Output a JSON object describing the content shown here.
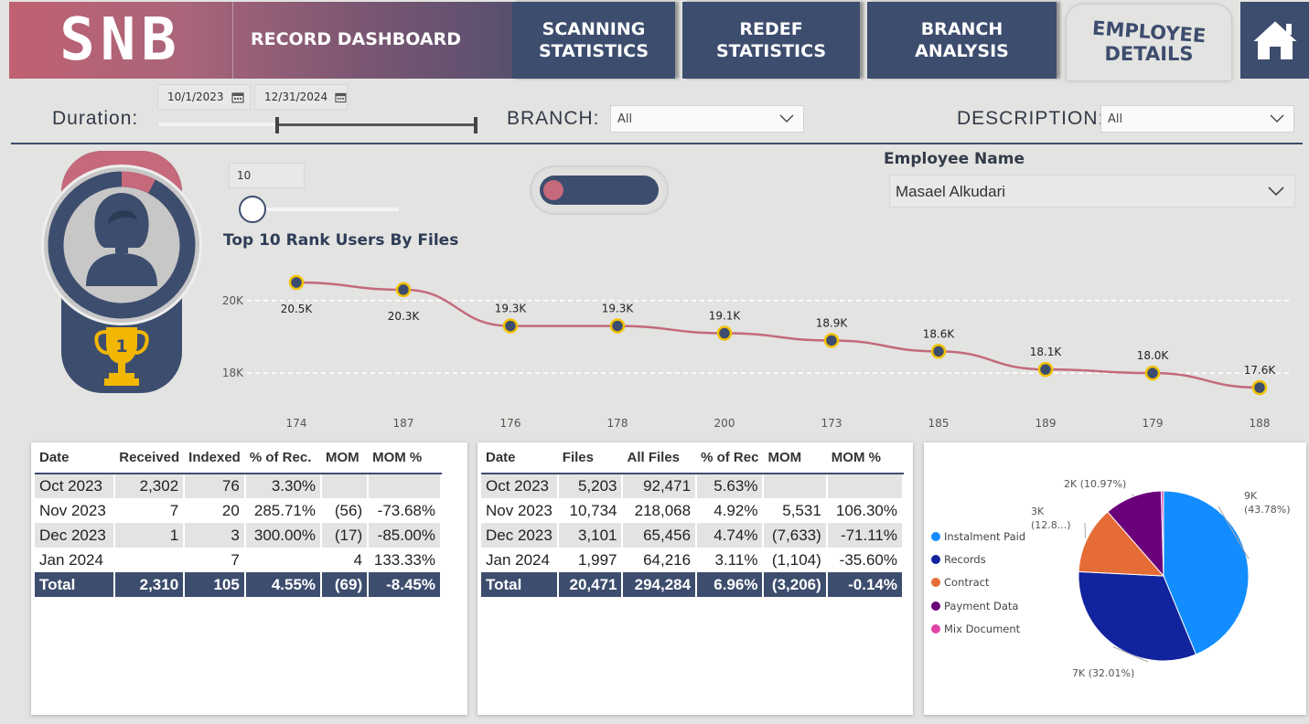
{
  "header": {
    "logo": "SNB",
    "title": "RECORD DASHBOARD",
    "tabs": [
      {
        "label_line1": "SCANNING",
        "label_line2": "STATISTICS"
      },
      {
        "label_line1": "REDEF",
        "label_line2": "STATISTICS"
      },
      {
        "label_line1": "BRANCH",
        "label_line2": "ANALYSIS"
      },
      {
        "label_line1": "EMPLOYEE",
        "label_line2": "DETAILS"
      }
    ],
    "home_icon": "home-icon"
  },
  "filters": {
    "duration_label": "Duration:",
    "start_date": "10/1/2023",
    "end_date": "12/31/2024",
    "branch_label": "BRANCH:",
    "branch_value": "All",
    "description_label": "DESCRIPTION:",
    "description_value": "All"
  },
  "rank": {
    "top_n_value": "10",
    "rank_number": "1",
    "chart_title": "Top 10 Rank Users By Files"
  },
  "employee": {
    "label": "Employee Name",
    "value": "Masael Alkudari"
  },
  "chart_data": [
    {
      "type": "line",
      "title": "Top 10 Rank Users By Files",
      "categories": [
        "174",
        "187",
        "176",
        "178",
        "200",
        "173",
        "185",
        "189",
        "179",
        "188"
      ],
      "values": [
        20500,
        20300,
        19300,
        19300,
        19100,
        18900,
        18600,
        18100,
        18000,
        17600
      ],
      "data_labels": [
        "20.5K",
        "20.3K",
        "19.3K",
        "19.3K",
        "19.1K",
        "18.9K",
        "18.6K",
        "18.1K",
        "18.0K",
        "17.6K"
      ],
      "y_ticks": [
        {
          "value": 18000,
          "label": "18K"
        },
        {
          "value": 20000,
          "label": "20K"
        }
      ],
      "ylim": [
        17250,
        20950
      ],
      "line_color": "#c26a7a",
      "marker_color": "#3d4d6e",
      "marker_edge": "#f2c200"
    },
    {
      "type": "pie",
      "slices": [
        {
          "name": "Instalment Paid",
          "label": "9K (43.78%)",
          "value": 43.78,
          "color": "#118dff"
        },
        {
          "name": "Records",
          "label": "7K (32.01%)",
          "value": 32.01,
          "color": "#12239e"
        },
        {
          "name": "Contract",
          "label": "3K (12.8...)",
          "value": 12.8,
          "color": "#e66c37"
        },
        {
          "name": "Payment Data",
          "label": "2K (10.97%)",
          "value": 10.97,
          "color": "#6b007b"
        },
        {
          "name": "Mix Document",
          "label": "",
          "value": 0.44,
          "color": "#e044a7"
        }
      ]
    }
  ],
  "table1": {
    "headers": [
      "Date",
      "Received",
      "Indexed",
      "% of Rec.",
      "MOM",
      "MOM %"
    ],
    "rows": [
      [
        "Oct 2023",
        "2,302",
        "76",
        "3.30%",
        "",
        ""
      ],
      [
        "Nov 2023",
        "7",
        "20",
        "285.71%",
        "(56)",
        "-73.68%"
      ],
      [
        "Dec 2023",
        "1",
        "3",
        "300.00%",
        "(17)",
        "-85.00%"
      ],
      [
        "Jan 2024",
        "",
        "7",
        "",
        "4",
        "133.33%"
      ]
    ],
    "total": [
      "Total",
      "2,310",
      "105",
      "4.55%",
      "(69)",
      "-8.45%"
    ]
  },
  "table2": {
    "headers": [
      "Date",
      "Files",
      "All Files",
      "% of Rec",
      "MOM",
      "MOM %"
    ],
    "rows": [
      [
        "Oct 2023",
        "5,203",
        "92,471",
        "5.63%",
        "",
        ""
      ],
      [
        "Nov 2023",
        "10,734",
        "218,068",
        "4.92%",
        "5,531",
        "106.30%"
      ],
      [
        "Dec 2023",
        "3,101",
        "65,456",
        "4.74%",
        "(7,633)",
        "-71.11%"
      ],
      [
        "Jan 2024",
        "1,997",
        "64,216",
        "3.11%",
        "(1,104)",
        "-35.60%"
      ]
    ],
    "total": [
      "Total",
      "20,471",
      "294,284",
      "6.96%",
      "(3,206)",
      "-0.14%"
    ]
  }
}
